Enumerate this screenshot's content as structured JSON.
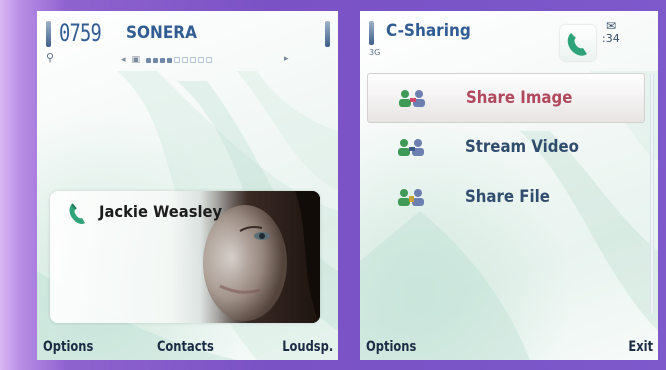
{
  "left_screen": {
    "status": {
      "clock": "0759",
      "operator": "SONERA",
      "signal_icon": "signal-strength-icon",
      "battery_icon": "battery-level-icon",
      "network_icon": "network-type-icon",
      "volume_icon": "speaker-volume-icon"
    },
    "call": {
      "caller_name": "Jackie Weasley",
      "call_icon": "phone-handset-icon"
    },
    "softkeys": {
      "left": "Options",
      "middle": "Contacts",
      "right": "Loudsp."
    }
  },
  "right_screen": {
    "title": "C-Sharing",
    "network_label": "3G",
    "time_fragment": ":34",
    "menu": [
      {
        "label": "Share Image",
        "icon": "share-image-icon",
        "selected": true
      },
      {
        "label": "Stream Video",
        "icon": "stream-video-icon",
        "selected": false
      },
      {
        "label": "Share File",
        "icon": "share-file-icon",
        "selected": false
      }
    ],
    "softkeys": {
      "left": "Options",
      "right": "Exit"
    }
  },
  "colors": {
    "background_purple": "#7b52c5",
    "title_blue": "#315d93",
    "selected_text": "#b0485e",
    "phone_green": "#2fa37a"
  }
}
